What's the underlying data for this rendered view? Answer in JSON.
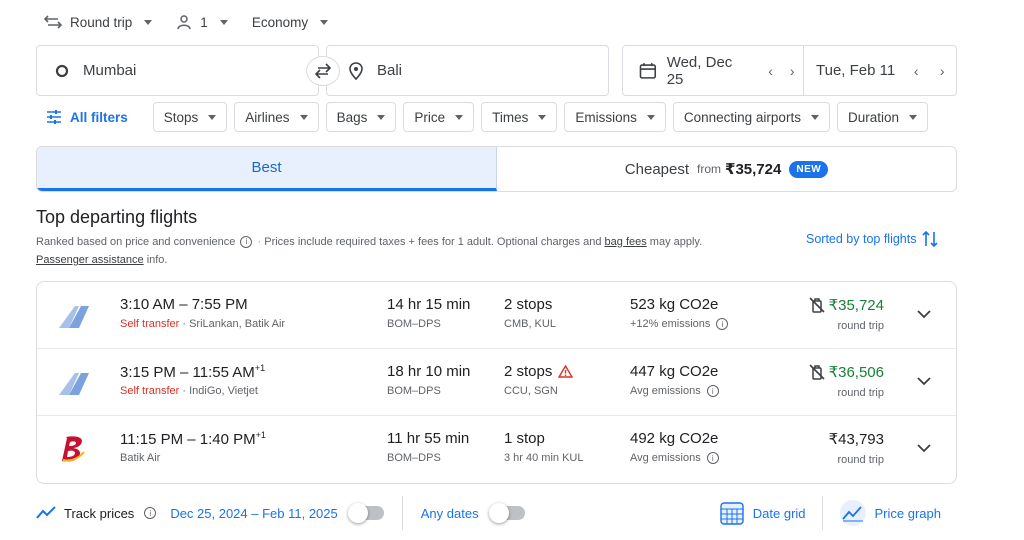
{
  "trip": {
    "trip_type": "Round trip",
    "passengers": "1",
    "cabin": "Economy"
  },
  "search": {
    "origin": "Mumbai",
    "destination": "Bali",
    "depart_date": "Wed, Dec 25",
    "return_date": "Tue, Feb 11"
  },
  "filters": {
    "all_filters": "All filters",
    "chips": [
      "Stops",
      "Airlines",
      "Bags",
      "Price",
      "Times",
      "Emissions",
      "Connecting airports",
      "Duration"
    ]
  },
  "tabs": {
    "best": "Best",
    "cheapest": "Cheapest",
    "from_label": "from",
    "cheapest_price": "₹35,724",
    "new_badge": "NEW"
  },
  "results": {
    "title": "Top departing flights",
    "subtitle_ranked": "Ranked based on price and convenience",
    "subtitle_prices": "Prices include required taxes + fees for 1 adult. Optional charges and",
    "bag_fees": "bag fees",
    "may_apply": "may apply.",
    "passenger_assistance": "Passenger assistance",
    "info": "info.",
    "sorted_by": "Sorted by top flights"
  },
  "flights": [
    {
      "depart_arrive": "3:10 AM – 7:55 PM",
      "plus_day": "",
      "self_transfer": "Self transfer",
      "airlines": "SriLankan, Batik Air",
      "duration": "14 hr 15 min",
      "route": "BOM–DPS",
      "stops": "2 stops",
      "stops_detail": "CMB, KUL",
      "co2": "523 kg CO2e",
      "emissions": "+12% emissions",
      "price": "₹35,724",
      "price_note": "round trip",
      "logo": "generic-airline-icon",
      "warning": false,
      "no_carryon": true
    },
    {
      "depart_arrive": "3:15 PM – 11:55 AM",
      "plus_day": "+1",
      "self_transfer": "Self transfer",
      "airlines": "IndiGo, Vietjet",
      "duration": "18 hr 10 min",
      "route": "BOM–DPS",
      "stops": "2 stops",
      "stops_detail": "CCU, SGN",
      "co2": "447 kg CO2e",
      "emissions": "Avg emissions",
      "price": "₹36,506",
      "price_note": "round trip",
      "logo": "generic-airline-icon",
      "warning": true,
      "no_carryon": true
    },
    {
      "depart_arrive": "11:15 PM – 1:40 PM",
      "plus_day": "+1",
      "self_transfer": "",
      "airlines": "Batik Air",
      "duration": "11 hr 55 min",
      "route": "BOM–DPS",
      "stops": "1 stop",
      "stops_detail": "3 hr 40 min KUL",
      "co2": "492 kg CO2e",
      "emissions": "Avg emissions",
      "price": "₹43,793",
      "price_note": "round trip",
      "logo": "batik-air-logo",
      "warning": false,
      "no_carryon": false
    }
  ],
  "footer": {
    "track_prices": "Track prices",
    "date_range": "Dec 25, 2024 – Feb 11, 2025",
    "any_dates": "Any dates",
    "date_grid": "Date grid",
    "price_graph": "Price graph"
  },
  "colors": {
    "accent": "#1a73e8",
    "green_price": "#188038",
    "self_transfer": "#d93025"
  }
}
